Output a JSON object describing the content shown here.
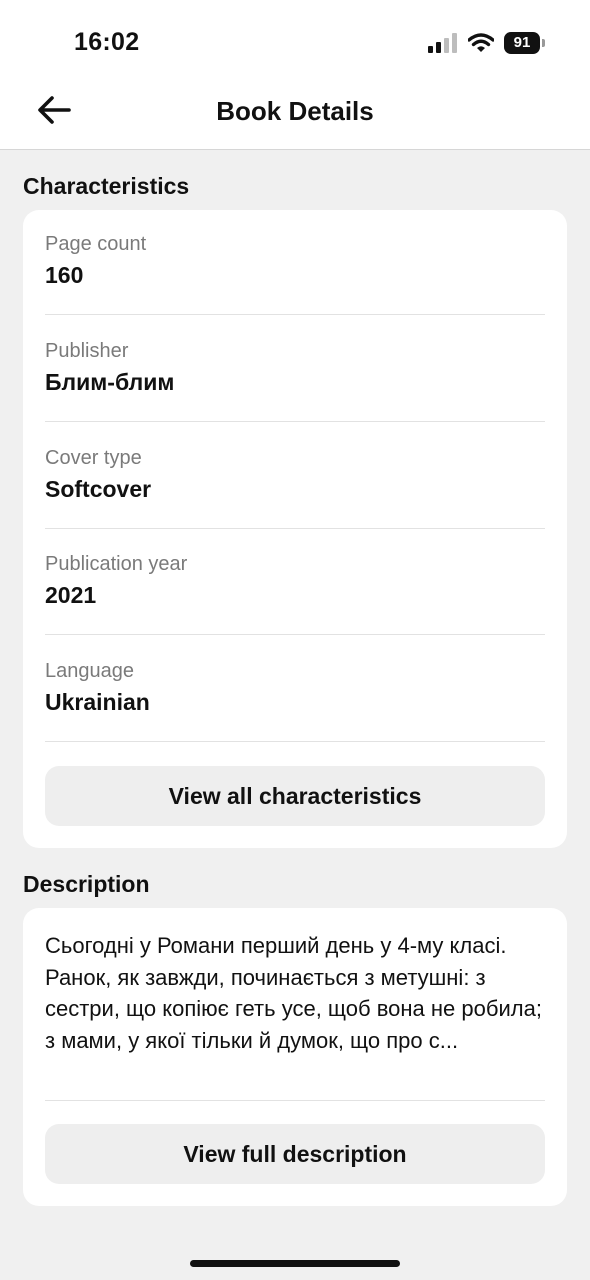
{
  "status": {
    "time": "16:02",
    "battery": "91"
  },
  "header": {
    "title": "Book Details"
  },
  "characteristics": {
    "title": "Characteristics",
    "items": [
      {
        "label": "Page count",
        "value": "160"
      },
      {
        "label": "Publisher",
        "value": "Блим-блим"
      },
      {
        "label": "Cover type",
        "value": "Softcover"
      },
      {
        "label": "Publication year",
        "value": "2021"
      },
      {
        "label": "Language",
        "value": "Ukrainian"
      }
    ],
    "button_label": "View all characteristics"
  },
  "description": {
    "title": "Description",
    "text": "Сьогодні у Романи перший день у 4-му класі. Ранок, як завжди, починається з метушні: з сестри, що копіює геть усе, щоб вона не робила; з мами, у якої тільки й думок, що про с...",
    "button_label": "View full description"
  }
}
